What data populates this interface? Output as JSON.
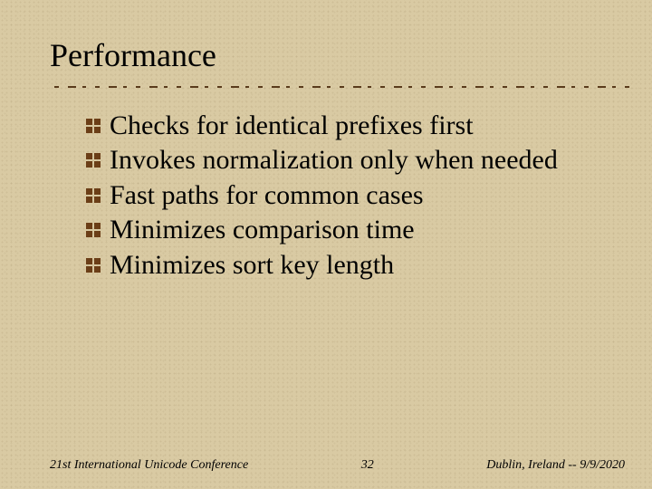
{
  "title": "Performance",
  "bullets": [
    "Checks for identical prefixes first",
    "Invokes normalization only when needed",
    "Fast paths for common cases",
    "Minimizes comparison time",
    "Minimizes sort key length"
  ],
  "footer": {
    "left": "21st International Unicode Conference",
    "center": "32",
    "right": "Dublin, Ireland -- 9/9/2020"
  },
  "colors": {
    "bullet_fill": "#6b3e17",
    "bullet_dark": "#3a1f0a"
  }
}
